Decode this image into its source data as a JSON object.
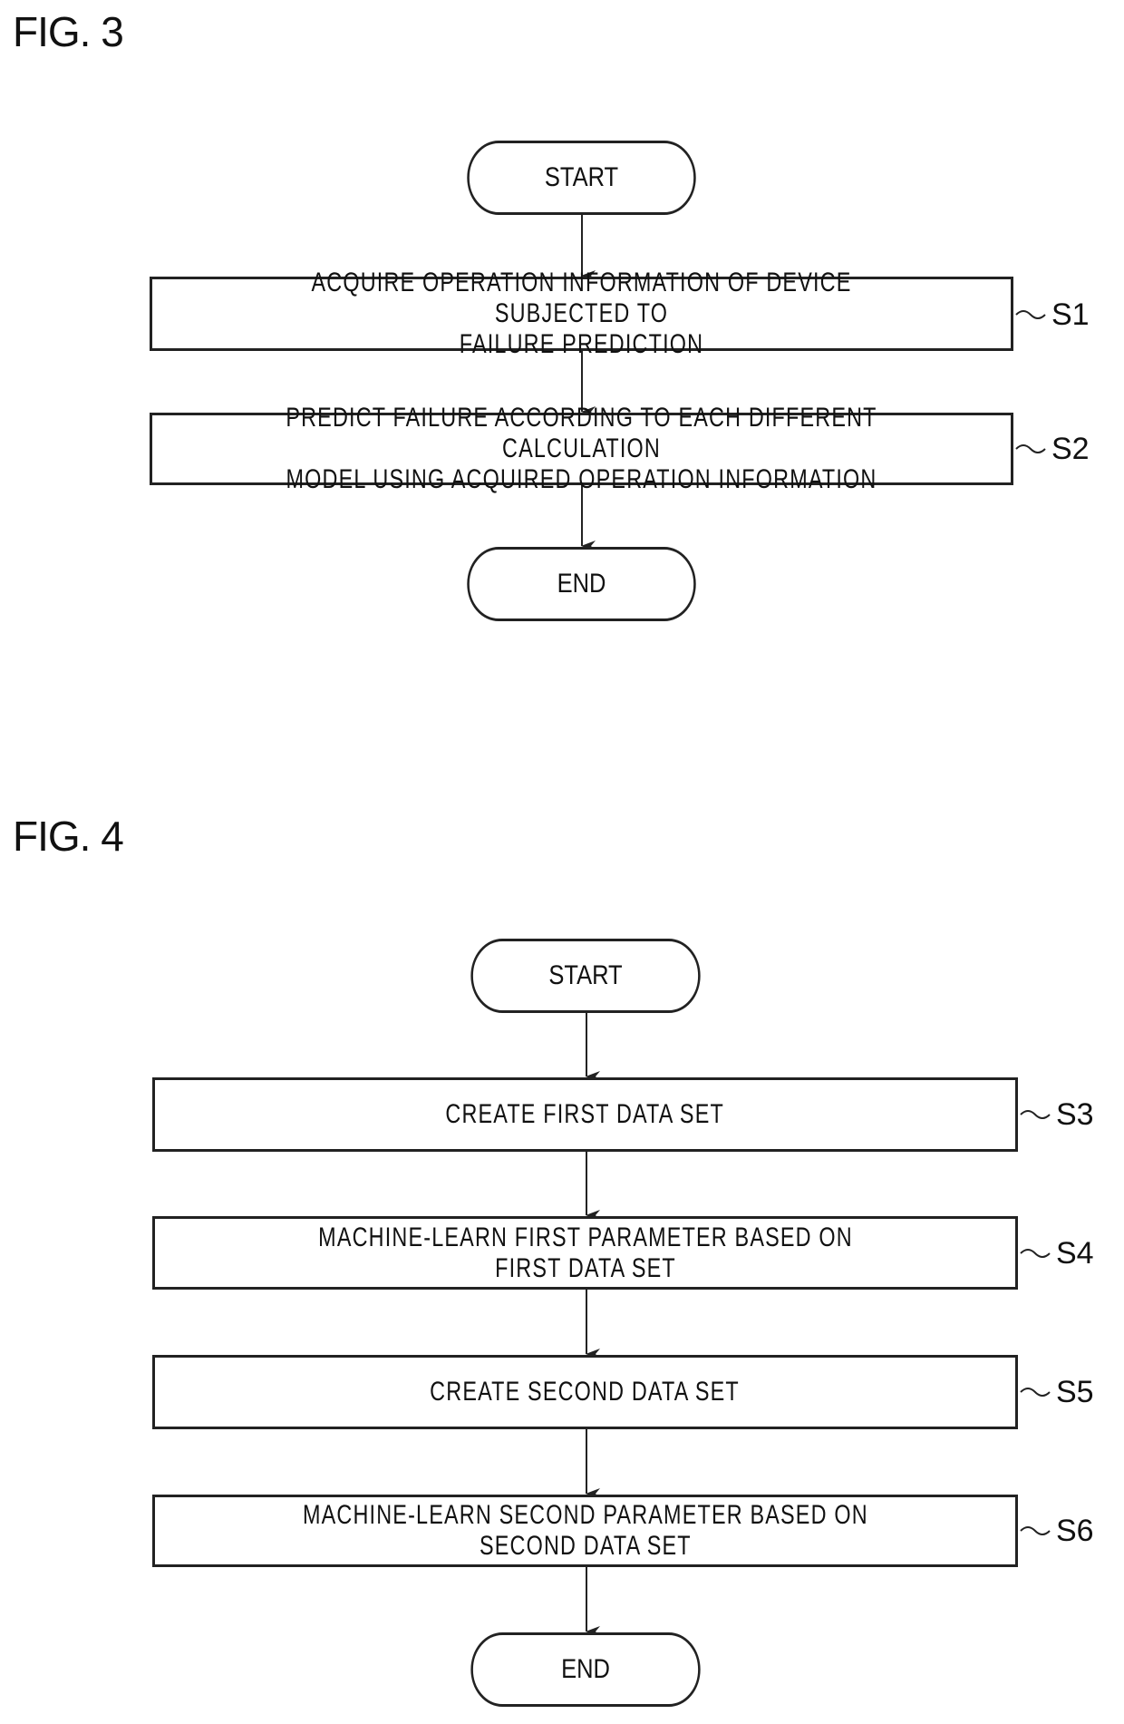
{
  "figures": [
    {
      "label": "FIG. 3",
      "start": "START",
      "end": "END",
      "steps": [
        {
          "id": "S1",
          "text": "ACQUIRE OPERATION INFORMATION OF DEVICE SUBJECTED TO\nFAILURE PREDICTION"
        },
        {
          "id": "S2",
          "text": "PREDICT FAILURE ACCORDING TO EACH DIFFERENT CALCULATION\nMODEL USING ACQUIRED OPERATION INFORMATION"
        }
      ]
    },
    {
      "label": "FIG. 4",
      "start": "START",
      "end": "END",
      "steps": [
        {
          "id": "S3",
          "text": "CREATE FIRST DATA SET"
        },
        {
          "id": "S4",
          "text": "MACHINE-LEARN FIRST PARAMETER BASED ON\nFIRST DATA SET"
        },
        {
          "id": "S5",
          "text": "CREATE SECOND DATA SET"
        },
        {
          "id": "S6",
          "text": "MACHINE-LEARN SECOND PARAMETER BASED ON\nSECOND DATA SET"
        }
      ]
    }
  ]
}
